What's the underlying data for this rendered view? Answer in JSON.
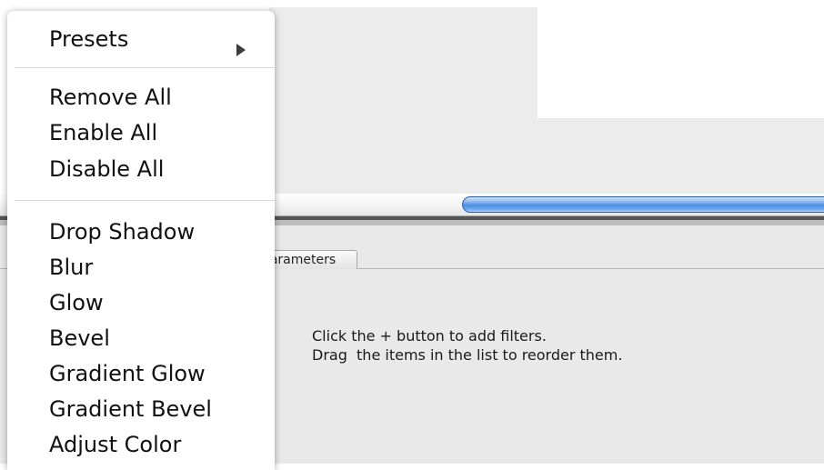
{
  "menu": {
    "presets_label": "Presets",
    "items_group1": [
      "Remove All",
      "Enable All",
      "Disable All"
    ],
    "filter_items": [
      "Drop Shadow",
      "Blur",
      "Glow",
      "Bevel",
      "Gradient Glow",
      "Gradient Bevel",
      "Adjust Color"
    ]
  },
  "tabs": {
    "parameters_label": "Parameters"
  },
  "hint": {
    "line1": "Click the + button to add filters.",
    "line2": "Drag  the items in the list to reorder them."
  },
  "colors": {
    "progress_blue": "#4d8ee3",
    "panel_gray": "#e9e9e9"
  }
}
